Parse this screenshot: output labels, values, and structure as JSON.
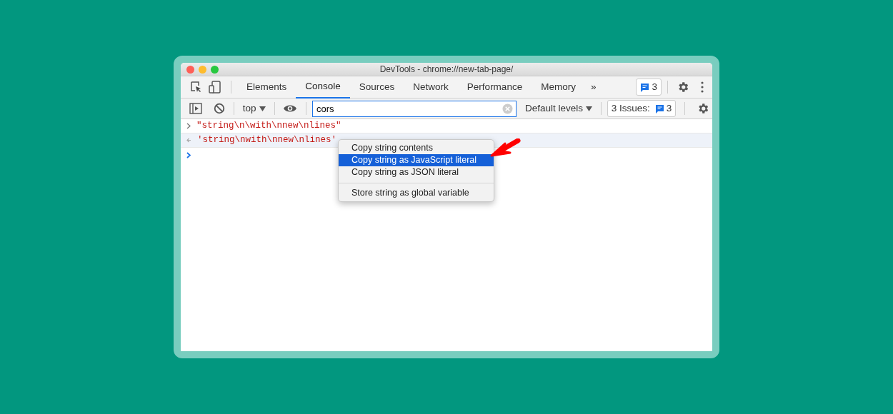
{
  "window": {
    "title": "DevTools - chrome://new-tab-page/"
  },
  "tabs": [
    {
      "label": "Elements",
      "selected": false
    },
    {
      "label": "Console",
      "selected": true
    },
    {
      "label": "Sources",
      "selected": false
    },
    {
      "label": "Network",
      "selected": false
    },
    {
      "label": "Performance",
      "selected": false
    },
    {
      "label": "Memory",
      "selected": false
    }
  ],
  "tab_overflow": "»",
  "messages_badge": "3",
  "toolbar": {
    "context": "top",
    "filter": "cors",
    "levels": "Default levels",
    "issues_label": "3 Issues:",
    "issues_count": "3"
  },
  "console_rows": [
    {
      "kind": "input",
      "text": "\"string\\n\\with\\nnew\\nlines\"",
      "highlighted": false
    },
    {
      "kind": "output",
      "text": "'string\\nwith\\nnew\\nlines'",
      "highlighted": true
    },
    {
      "kind": "prompt",
      "highlighted": false
    }
  ],
  "context_menu": [
    {
      "kind": "item",
      "label": "Copy string contents",
      "selected": false
    },
    {
      "kind": "item",
      "label": "Copy string as JavaScript literal",
      "selected": true
    },
    {
      "kind": "item",
      "label": "Copy string as JSON literal",
      "selected": false
    },
    {
      "kind": "separator"
    },
    {
      "kind": "item",
      "label": "Store string as global variable",
      "selected": false
    }
  ]
}
